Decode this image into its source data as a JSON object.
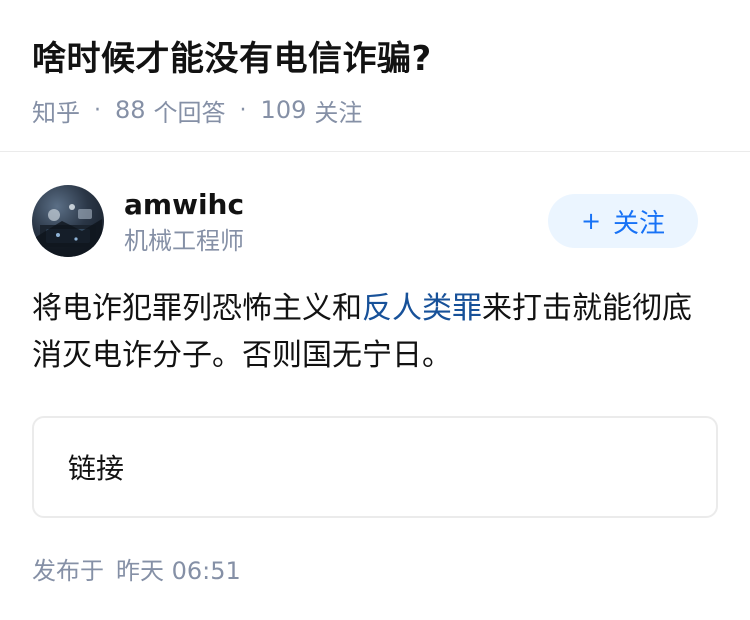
{
  "question": {
    "title": "啥时候才能没有电信诈骗?",
    "source": "知乎",
    "answer_count": "88",
    "answer_label": "个回答",
    "follower_count": "109",
    "follower_label": "关注"
  },
  "author": {
    "name": "amwihc",
    "title": "机械工程师",
    "follow_plus": "+",
    "follow_label": "关注"
  },
  "answer": {
    "text_before": "将电诈犯罪列恐怖主义和",
    "keyword": "反人类罪",
    "text_after": "来打击就能彻底消灭电诈分子。否则国无宁日。"
  },
  "link_card": {
    "label": "链接"
  },
  "publish": {
    "prefix": "发布于",
    "time": "昨天 06:51"
  },
  "colors": {
    "meta_gray": "#8590a6",
    "follow_bg": "#ebf5ff",
    "follow_text": "#1772f6",
    "keyword_link": "#175199"
  }
}
